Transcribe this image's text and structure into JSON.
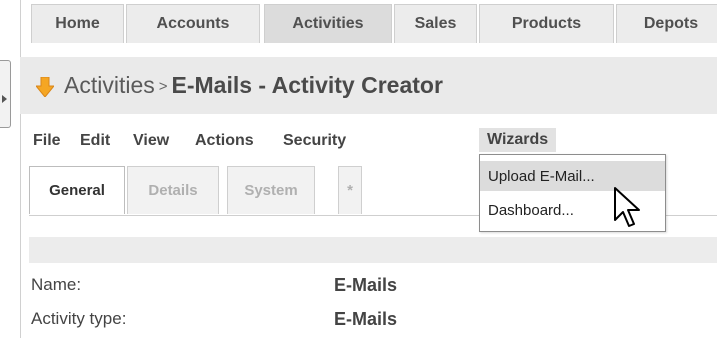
{
  "top_nav": {
    "tabs": [
      {
        "label": "Home"
      },
      {
        "label": "Accounts"
      },
      {
        "label": "Activities"
      },
      {
        "label": "Sales"
      },
      {
        "label": "Products"
      },
      {
        "label": "Depots"
      }
    ],
    "active_index": 2
  },
  "title_bar": {
    "icon": "down-arrow-icon",
    "module": "Activities",
    "separator": ">",
    "record": "E-Mails - Activity Creator",
    "icon_color": "#f5a623"
  },
  "menu": {
    "items": [
      "File",
      "Edit",
      "View",
      "Actions",
      "Security",
      "Wizards"
    ],
    "open_item": "Wizards",
    "dropdown": {
      "items": [
        "Upload E-Mail...",
        "Dashboard..."
      ],
      "hovered_index": 0
    }
  },
  "subtabs": {
    "items": [
      "General",
      "Details",
      "System",
      "*"
    ],
    "active_index": 0
  },
  "fields": [
    {
      "label": "Name:",
      "value": "E-Mails"
    },
    {
      "label": "Activity type:",
      "value": "E-Mails"
    }
  ]
}
